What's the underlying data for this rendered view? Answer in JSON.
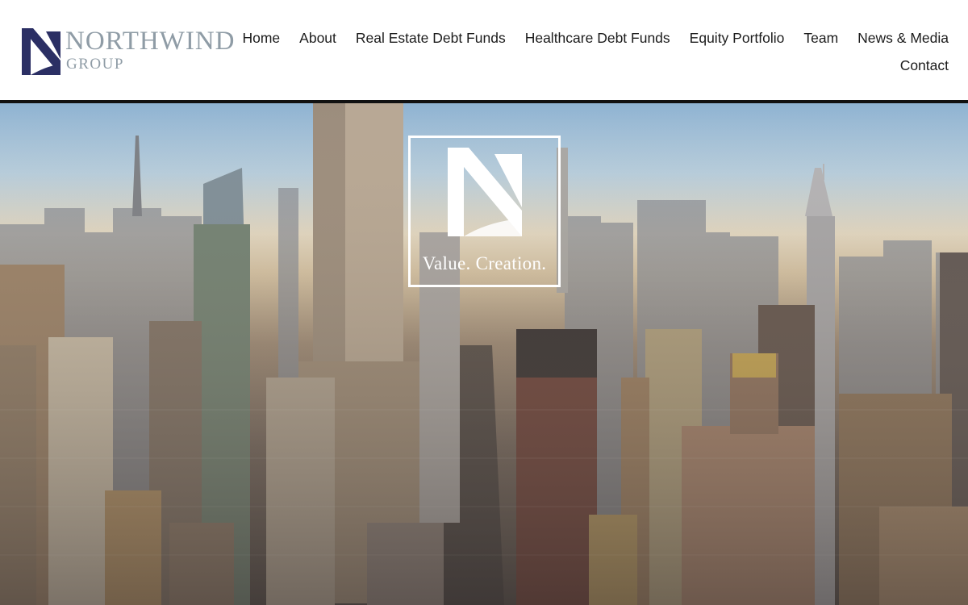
{
  "brand": {
    "name": "NORTHWIND",
    "sub": "GROUP",
    "mark_color": "#2b2f64",
    "word_color": "#8f9ca6",
    "icon": "nw-logo-icon"
  },
  "nav": {
    "row1": [
      {
        "label": "Home"
      },
      {
        "label": "About"
      },
      {
        "label": "Real Estate Debt Funds"
      },
      {
        "label": "Healthcare Debt Funds"
      },
      {
        "label": "Equity Portfolio"
      },
      {
        "label": "Team"
      },
      {
        "label": "News & Media"
      }
    ],
    "row2": [
      {
        "label": "Contact"
      }
    ]
  },
  "hero": {
    "tagline": "Value. Creation.",
    "image": "aerial photo of Manhattan skyline at sunrise"
  }
}
